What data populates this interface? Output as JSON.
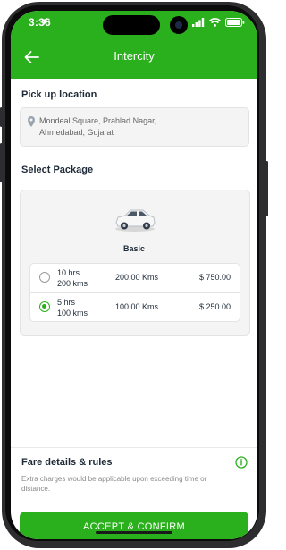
{
  "status_bar": {
    "time": "3:36"
  },
  "header": {
    "title": "Intercity"
  },
  "pickup": {
    "section_title": "Pick up location",
    "address_line1": "Mondeal Square, Prahlad Nagar,",
    "address_line2": "Ahmedabad, Gujarat"
  },
  "package": {
    "section_title": "Select Package",
    "name": "Basic",
    "options": [
      {
        "hours": "10 hrs",
        "kms": "200 kms",
        "distance": "200.00 Kms",
        "price": "$ 750.00",
        "selected": false
      },
      {
        "hours": "5 hrs",
        "kms": "100 kms",
        "distance": "100.00 Kms",
        "price": "$ 250.00",
        "selected": true
      }
    ]
  },
  "fare": {
    "title": "Fare details & rules",
    "description": "Extra charges would be applicable upon exceeding time or distance."
  },
  "accept_button": {
    "label": "ACCEPT & CONFIRM"
  },
  "theme": {
    "accent": "#2bb01d"
  }
}
